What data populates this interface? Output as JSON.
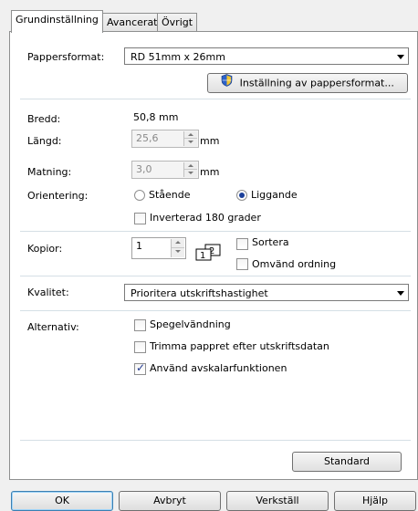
{
  "tabs": [
    {
      "label": "Grundinställning",
      "active": true
    },
    {
      "label": "Avancerat",
      "active": false
    },
    {
      "label": "Övrigt",
      "active": false
    }
  ],
  "paper": {
    "label": "Pappersformat:",
    "value": "RD 51mm x 26mm",
    "settings_button": "Inställning av pappersformat..."
  },
  "dimensions": {
    "width_label": "Bredd:",
    "width_value": "50,8 mm",
    "length_label": "Längd:",
    "length_value": "25,6",
    "length_unit": "mm",
    "feed_label": "Matning:",
    "feed_value": "3,0",
    "feed_unit": "mm"
  },
  "orientation": {
    "label": "Orientering:",
    "portrait": "Stående",
    "landscape": "Liggande",
    "selected": "landscape",
    "inverted_label": "Inverterad 180 grader",
    "inverted_checked": false
  },
  "copies": {
    "label": "Kopior:",
    "value": "1",
    "collate_label": "Sortera",
    "collate_checked": false,
    "reverse_label": "Omvänd ordning",
    "reverse_checked": false
  },
  "quality": {
    "label": "Kvalitet:",
    "value": "Prioritera utskriftshastighet"
  },
  "options": {
    "label": "Alternativ:",
    "items": [
      {
        "label": "Spegelvändning",
        "checked": false
      },
      {
        "label": "Trimma pappret efter utskriftsdatan",
        "checked": false
      },
      {
        "label": "Använd avskalarfunktionen",
        "checked": true
      }
    ]
  },
  "standard_button": "Standard",
  "footer": {
    "ok": "OK",
    "cancel": "Avbryt",
    "apply": "Verkställ",
    "help": "Hjälp"
  },
  "colors": {
    "panel_bg": "#ffffff",
    "window_bg": "#f0f0f0",
    "separator": "#d5dfe5",
    "check_accent": "#21398f"
  }
}
